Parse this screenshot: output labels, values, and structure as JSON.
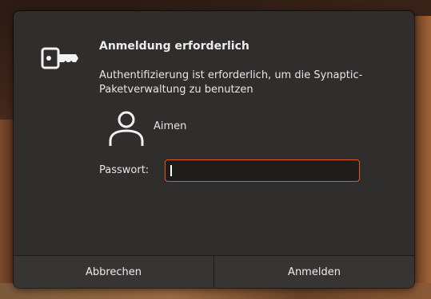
{
  "dialog": {
    "title": "Anmeldung erforderlich",
    "message": "Authentifizierung ist erforderlich, um die Synaptic-Paketverwaltung zu benutzen",
    "user": {
      "name": "Aimen",
      "icon": "avatar-icon"
    },
    "key_icon": "key-icon",
    "password": {
      "label": "Passwort:",
      "value": "",
      "placeholder": ""
    },
    "buttons": {
      "cancel": "Abbrechen",
      "authenticate": "Anmelden"
    },
    "colors": {
      "dialog_bg": "#2f2e2c",
      "focus_border": "#e95420",
      "text": "#e6e6e6"
    }
  }
}
